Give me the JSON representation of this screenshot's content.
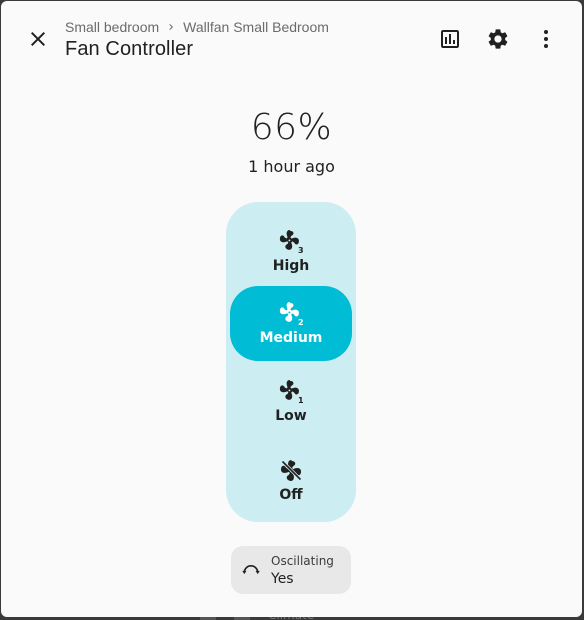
{
  "header": {
    "breadcrumb": [
      "Small bedroom",
      "Wallfan Small Bedroom"
    ],
    "title": "Fan Controller"
  },
  "state": {
    "value": "66%",
    "last_changed": "1 hour ago"
  },
  "speeds": [
    {
      "label": "High",
      "icon": "fan-speed-3-icon"
    },
    {
      "label": "Medium",
      "icon": "fan-speed-2-icon",
      "active": true
    },
    {
      "label": "Low",
      "icon": "fan-speed-1-icon"
    },
    {
      "label": "Off",
      "icon": "fan-off-icon"
    }
  ],
  "oscillation": {
    "label": "Oscillating",
    "value": "Yes"
  },
  "background_peek": "Climate",
  "colors": {
    "accent": "#00bcd4",
    "control_bg": "#cceef3",
    "dialog_bg": "#fafafa"
  }
}
